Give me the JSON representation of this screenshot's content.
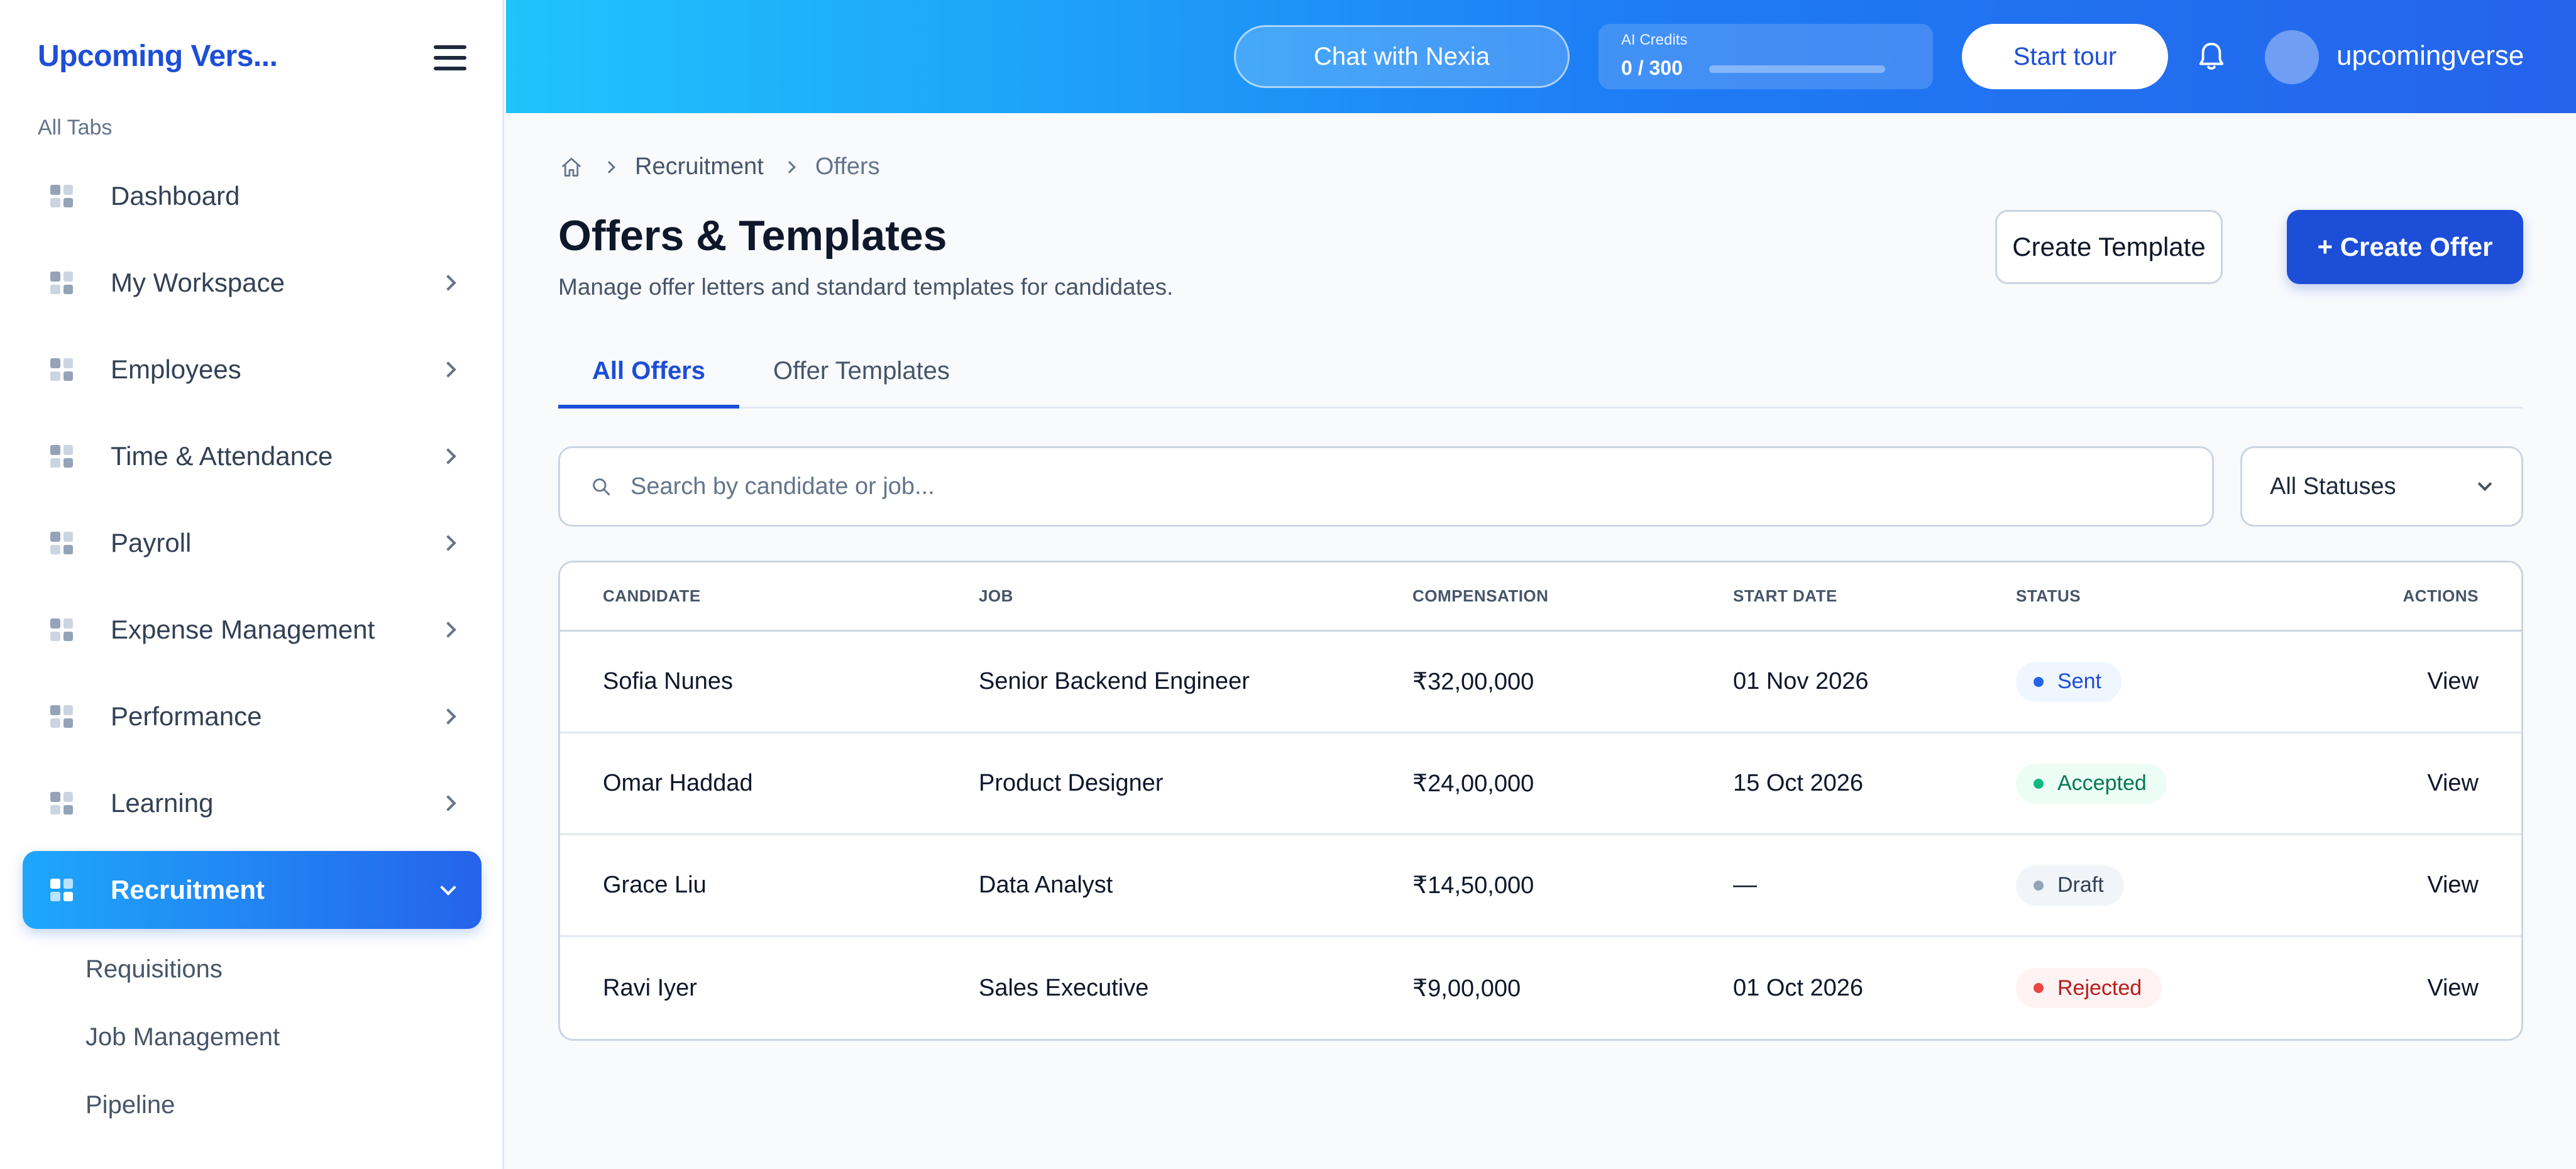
{
  "sidebar": {
    "brand": "Upcoming Vers...",
    "section_label": "All Tabs",
    "items": [
      {
        "label": "Dashboard"
      },
      {
        "label": "My Workspace"
      },
      {
        "label": "Employees"
      },
      {
        "label": "Time & Attendance"
      },
      {
        "label": "Payroll"
      },
      {
        "label": "Expense Management"
      },
      {
        "label": "Performance"
      },
      {
        "label": "Learning"
      },
      {
        "label": "Recruitment"
      }
    ],
    "sub_items": [
      {
        "label": "Requisitions"
      },
      {
        "label": "Job Management"
      },
      {
        "label": "Pipeline"
      }
    ]
  },
  "topbar": {
    "chat_label": "Chat with Nexia",
    "credits_label": "AI Credits",
    "credits_value": "0 / 300",
    "credits_used": 0,
    "tour_label": "Start tour",
    "username": "upcomingverse"
  },
  "breadcrumb": {
    "level1": "Recruitment",
    "level2": "Offers"
  },
  "page": {
    "title": "Offers & Templates",
    "subtitle": "Manage offer letters and standard templates for candidates.",
    "create_template_label": "Create Template",
    "create_offer_label": "+ Create Offer"
  },
  "tabs": [
    {
      "label": "All Offers"
    },
    {
      "label": "Offer Templates"
    }
  ],
  "search": {
    "placeholder": "Search by candidate or job..."
  },
  "filter": {
    "selected": "All Statuses"
  },
  "table": {
    "headers": {
      "candidate": "CANDIDATE",
      "job": "JOB",
      "compensation": "COMPENSATION",
      "start_date": "START DATE",
      "status": "STATUS",
      "actions": "ACTIONS"
    },
    "rows": [
      {
        "candidate": "Sofia Nunes",
        "job": "Senior Backend Engineer",
        "compensation": "₹32,00,000",
        "start_date": "01 Nov 2026",
        "status": "Sent",
        "action": "View"
      },
      {
        "candidate": "Omar Haddad",
        "job": "Product Designer",
        "compensation": "₹24,00,000",
        "start_date": "15 Oct 2026",
        "status": "Accepted",
        "action": "View"
      },
      {
        "candidate": "Grace Liu",
        "job": "Data Analyst",
        "compensation": "₹14,50,000",
        "start_date": "—",
        "status": "Draft",
        "action": "View"
      },
      {
        "candidate": "Ravi Iyer",
        "job": "Sales Executive",
        "compensation": "₹9,00,000",
        "start_date": "01 Oct 2026",
        "status": "Rejected",
        "action": "View"
      }
    ]
  },
  "colors": {
    "accent": "#1d4ed8",
    "sent_bg": "#eff6ff",
    "sent_fg": "#1d4ed8",
    "sent_dot": "#2563eb",
    "accepted_bg": "#ecfdf5",
    "accepted_fg": "#047857",
    "accepted_dot": "#10b981",
    "draft_bg": "#f1f5f9",
    "draft_fg": "#334155",
    "draft_dot": "#94a3b8",
    "rejected_bg": "#fef2f2",
    "rejected_fg": "#b91c1c",
    "rejected_dot": "#ef4444"
  },
  "icons": {
    "nav": "grid-icon",
    "menu": "hamburger-icon",
    "bell": "bell-icon",
    "home": "home-icon",
    "search": "search-icon",
    "chevron": "chevron-right-icon",
    "dropdown": "chevron-down-icon"
  }
}
